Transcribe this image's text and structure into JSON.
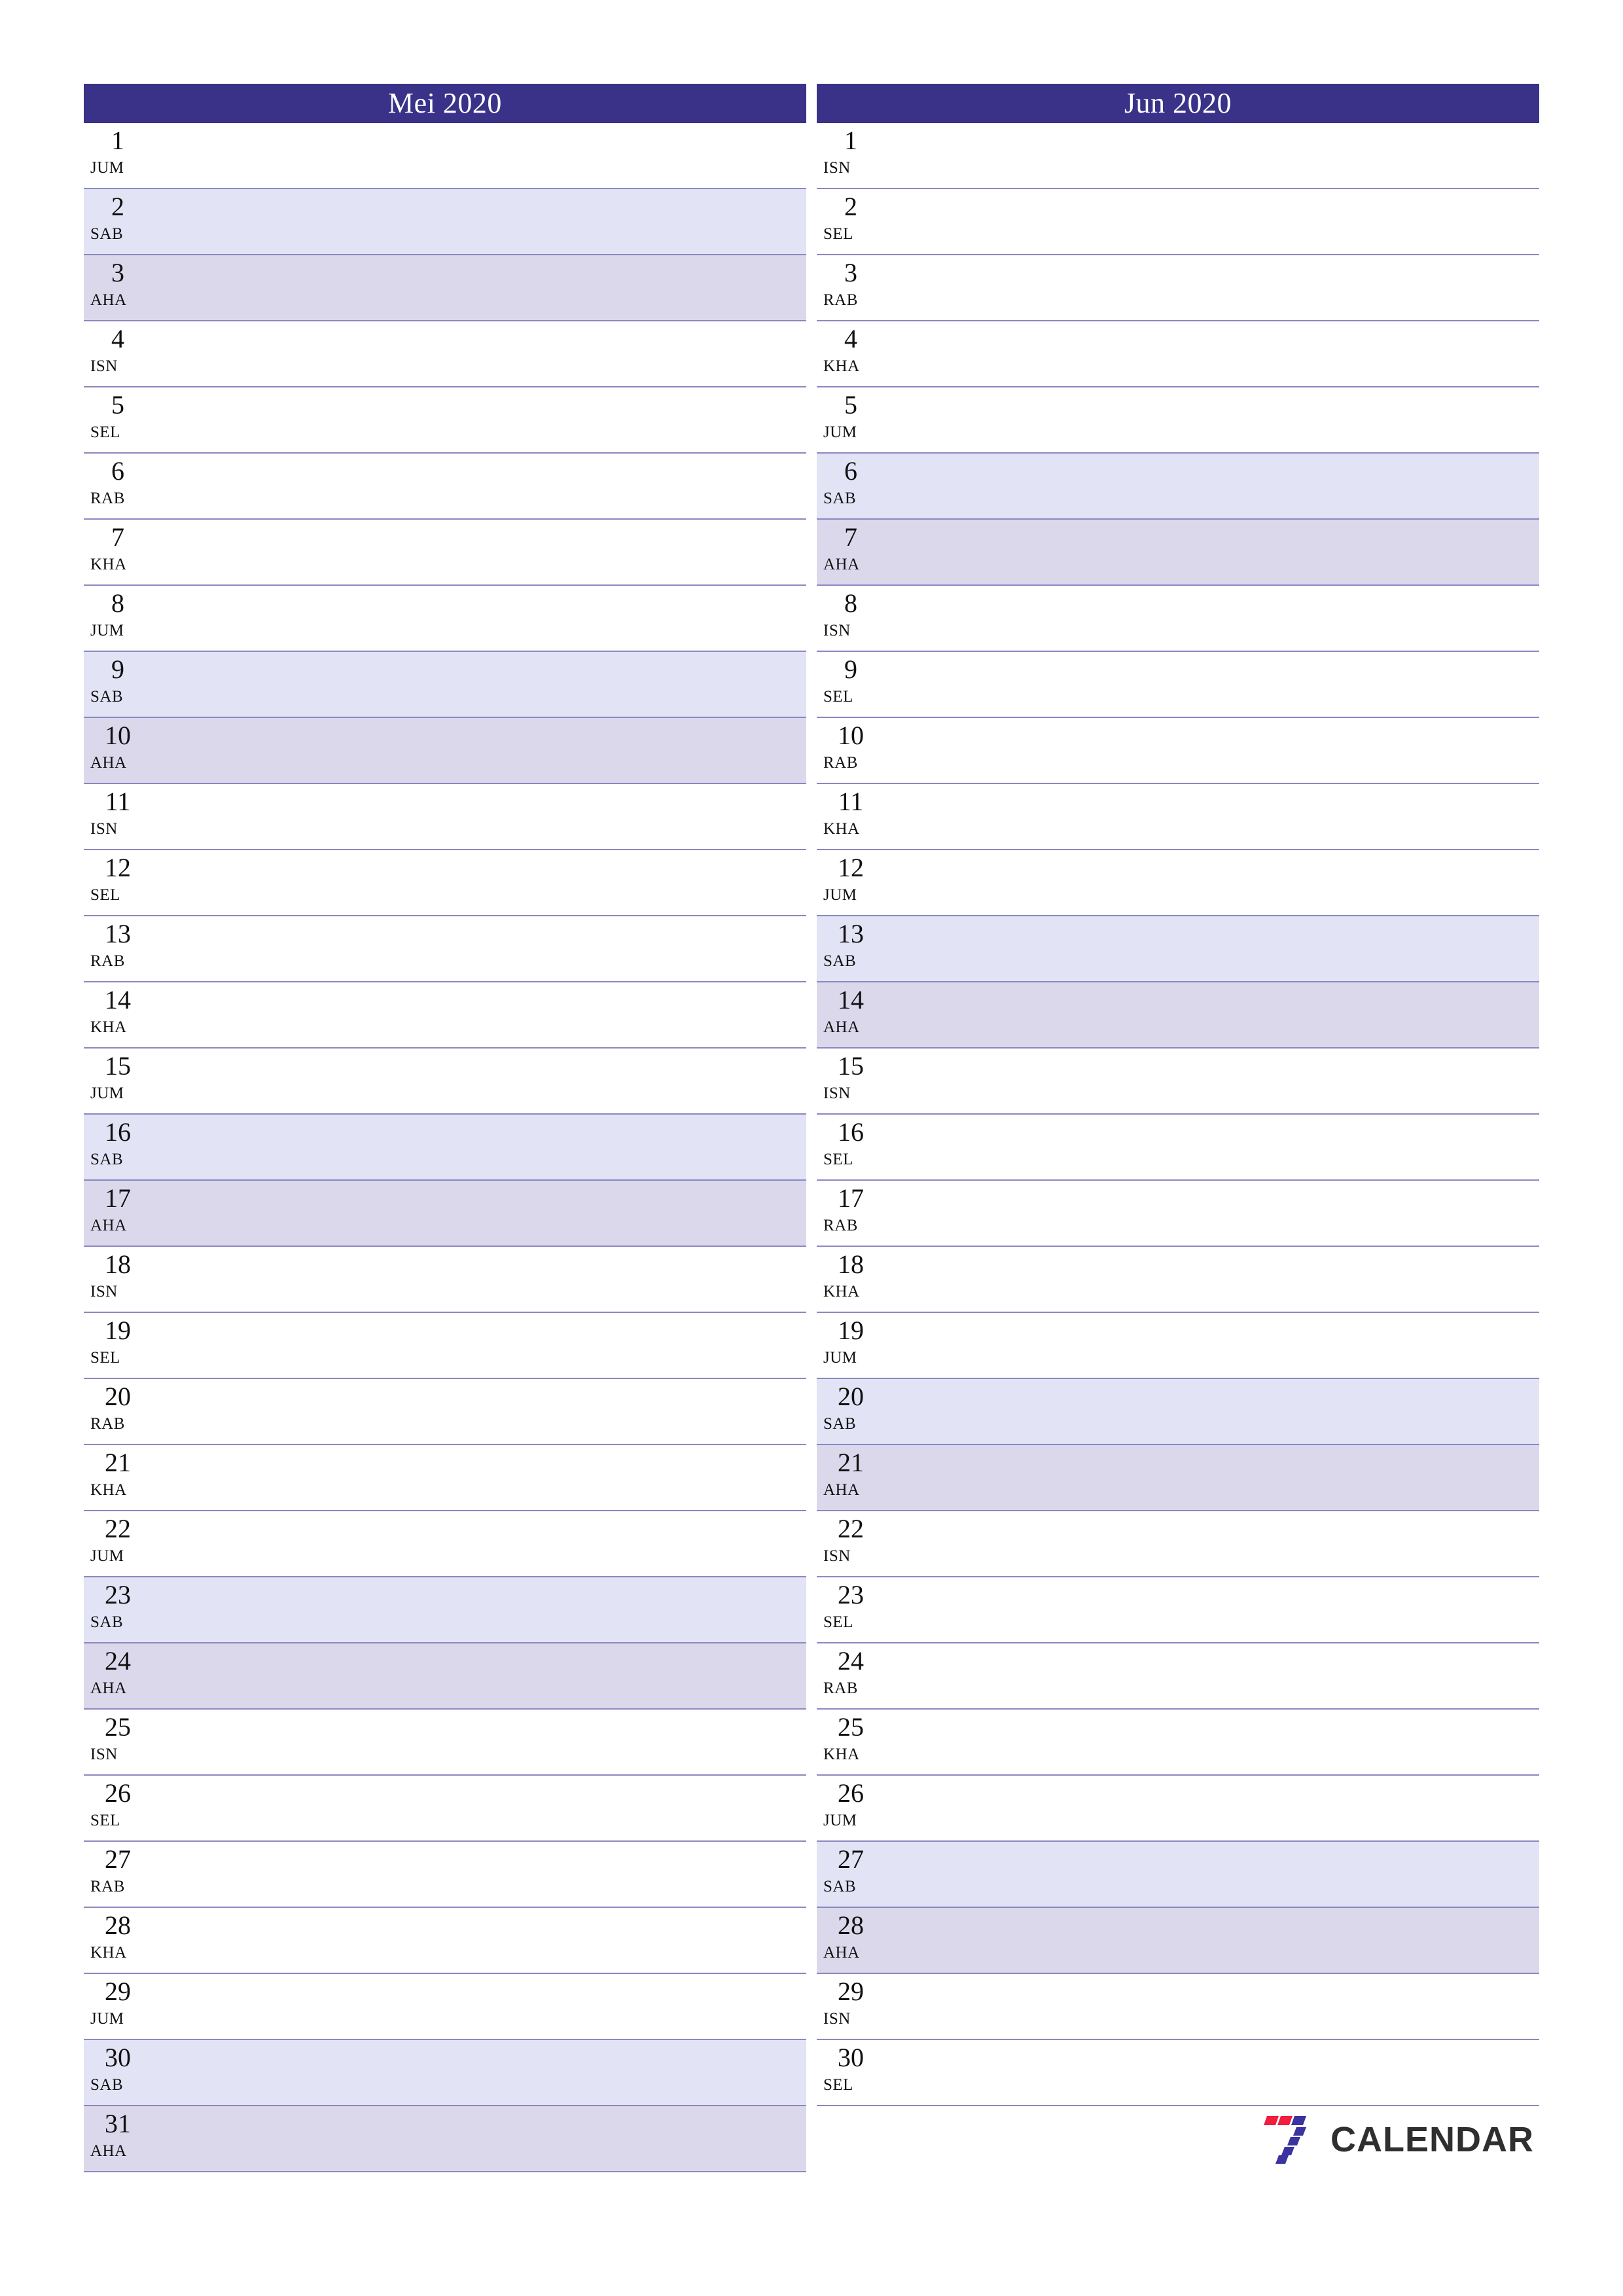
{
  "document": {
    "type": "monthly-planner",
    "locale_labels": {
      "weekday_abbrs": [
        "ISN",
        "SEL",
        "RAB",
        "KHA",
        "JUM",
        "SAB",
        "AHA"
      ]
    }
  },
  "colors": {
    "header_bg": "#393288",
    "header_text": "#ffffff",
    "saturday_bg": "#e3e3f6",
    "sunday_bg": "#dcd8ec",
    "row_line": "#8b88c0",
    "day_text": "#111111",
    "brand_red": "#f21d3f",
    "brand_blue": "#3b33a0",
    "brand_word": "#2f2f2f",
    "page_bg": "#ffffff"
  },
  "brand": {
    "name": "CALENDAR",
    "mark": "seven-logo-icon"
  },
  "months": [
    {
      "title": "Mei 2020",
      "days": [
        {
          "num": "1",
          "dow": "JUM"
        },
        {
          "num": "2",
          "dow": "SAB"
        },
        {
          "num": "3",
          "dow": "AHA"
        },
        {
          "num": "4",
          "dow": "ISN"
        },
        {
          "num": "5",
          "dow": "SEL"
        },
        {
          "num": "6",
          "dow": "RAB"
        },
        {
          "num": "7",
          "dow": "KHA"
        },
        {
          "num": "8",
          "dow": "JUM"
        },
        {
          "num": "9",
          "dow": "SAB"
        },
        {
          "num": "10",
          "dow": "AHA"
        },
        {
          "num": "11",
          "dow": "ISN"
        },
        {
          "num": "12",
          "dow": "SEL"
        },
        {
          "num": "13",
          "dow": "RAB"
        },
        {
          "num": "14",
          "dow": "KHA"
        },
        {
          "num": "15",
          "dow": "JUM"
        },
        {
          "num": "16",
          "dow": "SAB"
        },
        {
          "num": "17",
          "dow": "AHA"
        },
        {
          "num": "18",
          "dow": "ISN"
        },
        {
          "num": "19",
          "dow": "SEL"
        },
        {
          "num": "20",
          "dow": "RAB"
        },
        {
          "num": "21",
          "dow": "KHA"
        },
        {
          "num": "22",
          "dow": "JUM"
        },
        {
          "num": "23",
          "dow": "SAB"
        },
        {
          "num": "24",
          "dow": "AHA"
        },
        {
          "num": "25",
          "dow": "ISN"
        },
        {
          "num": "26",
          "dow": "SEL"
        },
        {
          "num": "27",
          "dow": "RAB"
        },
        {
          "num": "28",
          "dow": "KHA"
        },
        {
          "num": "29",
          "dow": "JUM"
        },
        {
          "num": "30",
          "dow": "SAB"
        },
        {
          "num": "31",
          "dow": "AHA"
        }
      ]
    },
    {
      "title": "Jun 2020",
      "days": [
        {
          "num": "1",
          "dow": "ISN"
        },
        {
          "num": "2",
          "dow": "SEL"
        },
        {
          "num": "3",
          "dow": "RAB"
        },
        {
          "num": "4",
          "dow": "KHA"
        },
        {
          "num": "5",
          "dow": "JUM"
        },
        {
          "num": "6",
          "dow": "SAB"
        },
        {
          "num": "7",
          "dow": "AHA"
        },
        {
          "num": "8",
          "dow": "ISN"
        },
        {
          "num": "9",
          "dow": "SEL"
        },
        {
          "num": "10",
          "dow": "RAB"
        },
        {
          "num": "11",
          "dow": "KHA"
        },
        {
          "num": "12",
          "dow": "JUM"
        },
        {
          "num": "13",
          "dow": "SAB"
        },
        {
          "num": "14",
          "dow": "AHA"
        },
        {
          "num": "15",
          "dow": "ISN"
        },
        {
          "num": "16",
          "dow": "SEL"
        },
        {
          "num": "17",
          "dow": "RAB"
        },
        {
          "num": "18",
          "dow": "KHA"
        },
        {
          "num": "19",
          "dow": "JUM"
        },
        {
          "num": "20",
          "dow": "SAB"
        },
        {
          "num": "21",
          "dow": "AHA"
        },
        {
          "num": "22",
          "dow": "ISN"
        },
        {
          "num": "23",
          "dow": "SEL"
        },
        {
          "num": "24",
          "dow": "RAB"
        },
        {
          "num": "25",
          "dow": "KHA"
        },
        {
          "num": "26",
          "dow": "JUM"
        },
        {
          "num": "27",
          "dow": "SAB"
        },
        {
          "num": "28",
          "dow": "AHA"
        },
        {
          "num": "29",
          "dow": "ISN"
        },
        {
          "num": "30",
          "dow": "SEL"
        }
      ]
    }
  ]
}
